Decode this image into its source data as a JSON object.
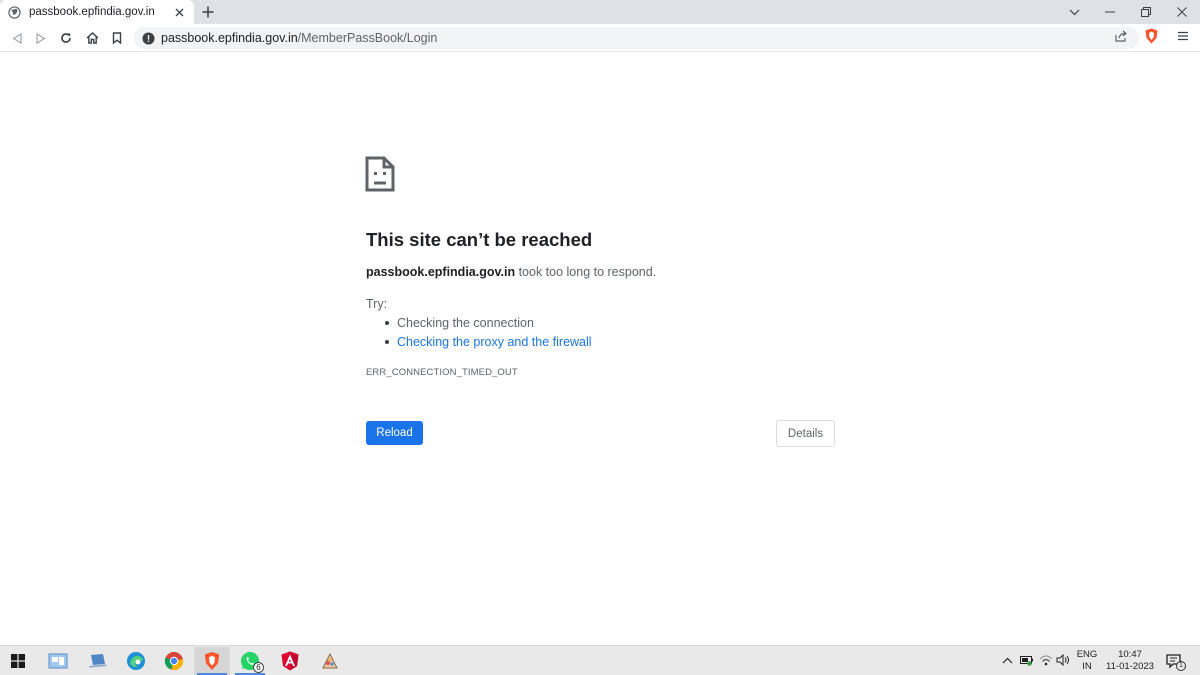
{
  "browser": {
    "tab": {
      "title": "passbook.epfindia.gov.in"
    },
    "url": {
      "host": "passbook.epfindia.gov.in",
      "path": "/MemberPassBook/Login"
    }
  },
  "error_page": {
    "title": "This site can’t be reached",
    "message_host": "passbook.epfindia.gov.in",
    "message_rest": " took too long to respond.",
    "try_label": "Try:",
    "suggestions": [
      "Checking the connection",
      "Checking the proxy and the firewall"
    ],
    "error_code": "ERR_CONNECTION_TIMED_OUT",
    "reload_label": "Reload",
    "details_label": "Details"
  },
  "taskbar": {
    "whatsapp_badge": "6",
    "language": {
      "top": "ENG",
      "bottom": "IN"
    },
    "clock": {
      "time": "10:47",
      "date": "11-01-2023"
    },
    "notification_count": "1"
  },
  "colors": {
    "accent": "#1a73e8",
    "brave_orange": "#fb542b",
    "taskbar_active": "#4a8ad8"
  }
}
